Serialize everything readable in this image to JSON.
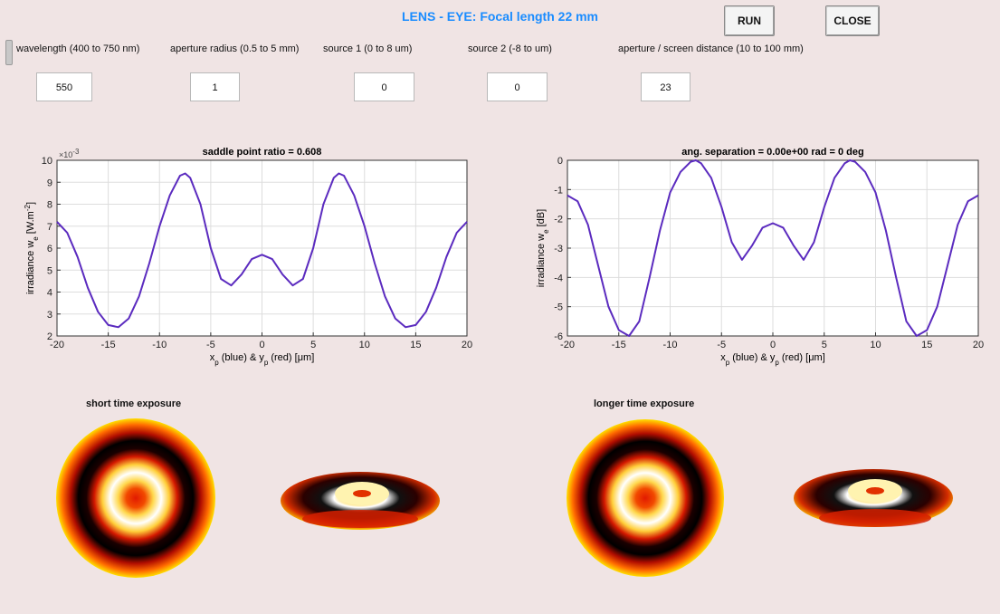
{
  "window": {
    "title": "LENS - EYE: Focal length 22 mm"
  },
  "colors": {
    "title": "#1a8cff",
    "curve": "#5b2bbf",
    "background": "#f0e4e4",
    "plot_bg": "#ffffff",
    "grid": "#dddddd"
  },
  "buttons": {
    "run": "RUN",
    "close": "CLOSE"
  },
  "params": [
    {
      "label": "wavelength (400 to 750 nm)",
      "value": "550"
    },
    {
      "label": "aperture radius (0.5 to 5 mm)",
      "value": "1"
    },
    {
      "label": "source 1 (0 to 8 um)",
      "value": "0"
    },
    {
      "label": "source 2 (-8 to um)",
      "value": "0"
    },
    {
      "label": "aperture / screen distance (10 to 100 mm)",
      "value": "23"
    }
  ],
  "sections": {
    "short": "short time exposure",
    "long": "longer time exposure"
  },
  "chart_data": [
    {
      "type": "line",
      "title": "saddle point ratio =  0.608",
      "xlabel": "x_p (blue) & y_p (red)  [μm]",
      "ylabel": "irradiance w_e  [W.m^-2]",
      "exponent_label": "×10^-3",
      "xlim": [
        -20,
        20
      ],
      "ylim": [
        2,
        10
      ],
      "xticks": [
        -20,
        -15,
        -10,
        -5,
        0,
        5,
        10,
        15,
        20
      ],
      "yticks": [
        2,
        3,
        4,
        5,
        6,
        7,
        8,
        9,
        10
      ],
      "grid": true,
      "series": [
        {
          "x": [
            -20,
            -19,
            -18,
            -17,
            -16,
            -15,
            -14,
            -13,
            -12,
            -11,
            -10,
            -9,
            -8,
            -7.5,
            -7,
            -6,
            -5,
            -4,
            -3,
            -2,
            -1,
            0,
            1,
            2,
            3,
            4,
            5,
            6,
            7,
            7.5,
            8,
            9,
            10,
            11,
            12,
            13,
            14,
            15,
            16,
            17,
            18,
            19,
            20
          ],
          "values": [
            7.2,
            6.7,
            5.6,
            4.2,
            3.1,
            2.5,
            2.4,
            2.8,
            3.8,
            5.3,
            7.0,
            8.4,
            9.3,
            9.4,
            9.2,
            8.0,
            6.0,
            4.6,
            4.3,
            4.8,
            5.5,
            5.7,
            5.5,
            4.8,
            4.3,
            4.6,
            6.0,
            8.0,
            9.2,
            9.4,
            9.3,
            8.4,
            7.0,
            5.3,
            3.8,
            2.8,
            2.4,
            2.5,
            3.1,
            4.2,
            5.6,
            6.7,
            7.2
          ]
        }
      ]
    },
    {
      "type": "line",
      "title": "ang. separation  =  0.00e+00 rad =  0  deg",
      "xlabel": "x_p (blue) & y_p (red)  [μm]",
      "ylabel": "irradiance w_e  [dB]",
      "xlim": [
        -20,
        20
      ],
      "ylim": [
        -6,
        0
      ],
      "xticks": [
        -20,
        -15,
        -10,
        -5,
        0,
        5,
        10,
        15,
        20
      ],
      "yticks": [
        -6,
        -5,
        -4,
        -3,
        -2,
        -1,
        0
      ],
      "grid": true,
      "series": [
        {
          "x": [
            -20,
            -19,
            -18,
            -17,
            -16,
            -15,
            -14,
            -13,
            -12,
            -11,
            -10,
            -9,
            -8,
            -7.5,
            -7,
            -6,
            -5,
            -4,
            -3,
            -2,
            -1,
            0,
            1,
            2,
            3,
            4,
            5,
            6,
            7,
            7.5,
            8,
            9,
            10,
            11,
            12,
            13,
            14,
            15,
            16,
            17,
            18,
            19,
            20
          ],
          "values": [
            -1.2,
            -1.4,
            -2.2,
            -3.6,
            -5.0,
            -5.8,
            -6.0,
            -5.5,
            -4.0,
            -2.4,
            -1.1,
            -0.4,
            -0.05,
            0.0,
            -0.1,
            -0.6,
            -1.6,
            -2.8,
            -3.4,
            -2.9,
            -2.3,
            -2.15,
            -2.3,
            -2.9,
            -3.4,
            -2.8,
            -1.6,
            -0.6,
            -0.1,
            0.0,
            -0.05,
            -0.4,
            -1.1,
            -2.4,
            -4.0,
            -5.5,
            -6.0,
            -5.8,
            -5.0,
            -3.6,
            -2.2,
            -1.4,
            -1.2
          ]
        }
      ]
    }
  ]
}
